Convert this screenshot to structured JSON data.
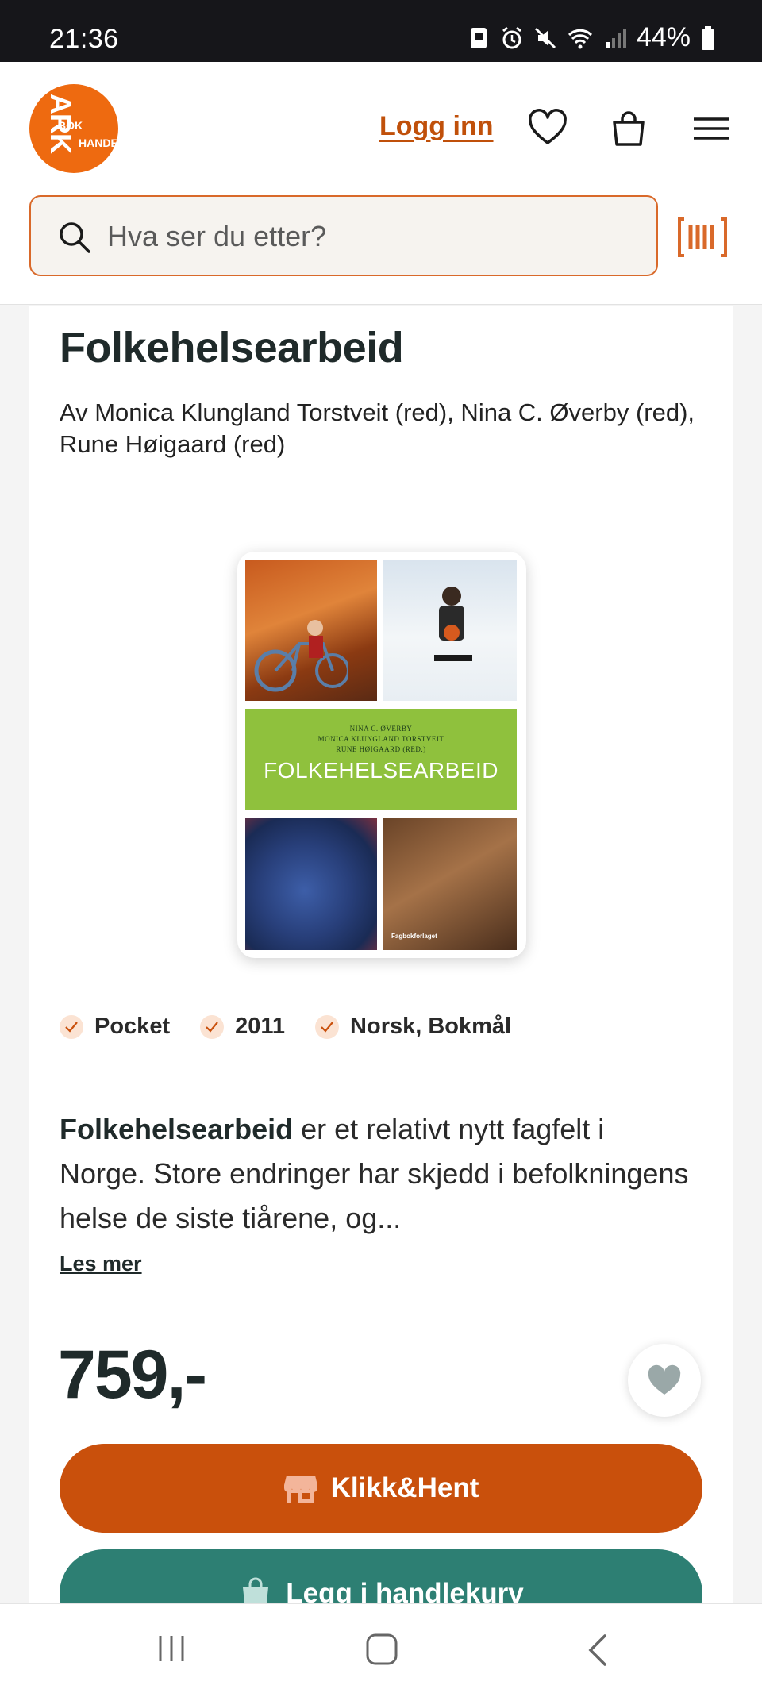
{
  "status_bar": {
    "time": "21:36",
    "battery": "44%"
  },
  "header": {
    "logo_text_ark": "ARK",
    "logo_text_bok": "BOK",
    "logo_text_handel": "HANDEL",
    "login_label": "Logg inn",
    "search_placeholder": "Hva ser du etter?",
    "accent_color": "#ee6a10"
  },
  "product": {
    "title": "Folkehelsearbeid",
    "authors": "Av Monica Klungland Torstveit (red), Nina C. Øverby (red), Rune Høigaard (red)",
    "cover": {
      "line1": "NINA C. ØVERBY",
      "line2": "MONICA KLUNGLAND TORSTVEIT",
      "line3": "RUNE HØIGAARD (RED.)",
      "title": "FOLKEHELSEARBEID",
      "publisher": "Fagbokforlaget"
    },
    "tags": [
      "Pocket",
      "2011",
      "Norsk, Bokmål"
    ],
    "description_bold": "Folkehelsearbeid",
    "description_rest": " er et relativt nytt fagfelt i Norge. Store endringer har skjedd i befolkningens helse de siste tiårene, og...",
    "read_more": "Les mer",
    "price": "759,-",
    "click_collect_label": "Klikk&Hent",
    "add_to_cart_label": "Legg i handlekurv"
  },
  "colors": {
    "click_collect": "#c9500c",
    "add_to_cart": "#2d7f73"
  }
}
